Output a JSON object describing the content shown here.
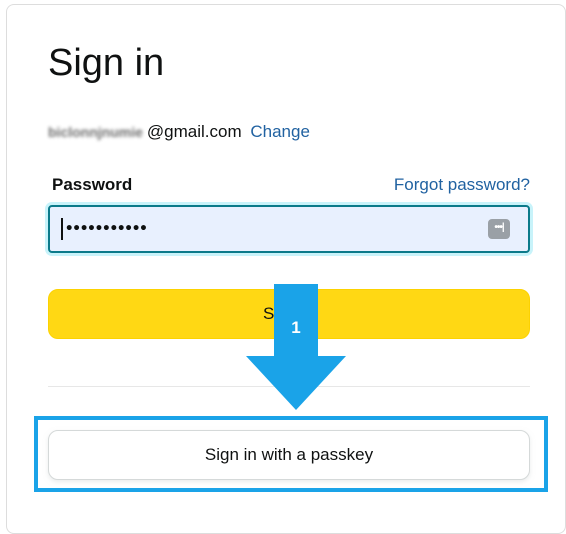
{
  "page": {
    "title": "Sign in"
  },
  "account": {
    "email_user": "biclonnjnumie",
    "email_domain": "@gmail.com",
    "change_label": "Change"
  },
  "password": {
    "label": "Password",
    "forgot_label": "Forgot password?",
    "masked_value": "•••••••••••"
  },
  "buttons": {
    "signin_label": "Sign in",
    "passkey_label": "Sign in with a passkey"
  },
  "annotation": {
    "step_number": "1",
    "color": "#1aa3e8"
  },
  "colors": {
    "primary_button": "#ffd814",
    "link": "#2162a1",
    "input_focus_border": "#0b7a8a"
  }
}
